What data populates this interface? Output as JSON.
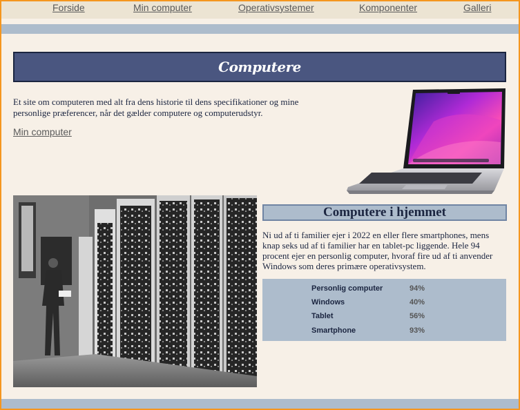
{
  "nav": {
    "items": [
      {
        "label": "Forside"
      },
      {
        "label": "Min computer"
      },
      {
        "label": "Operativsystemer"
      },
      {
        "label": "Komponenter"
      },
      {
        "label": "Galleri"
      }
    ]
  },
  "hero": {
    "title": "Computere"
  },
  "intro": {
    "text": "Et site om computeren med alt fra dens historie til dens specifikationer og mine personlige præferencer, når det gælder computere og computerudstyr.",
    "link_label": "Min computer"
  },
  "images": {
    "laptop": "laptop-photo",
    "servers": "server-room-photo"
  },
  "home_section": {
    "heading": "Computere i hjemmet",
    "body": "Ni ud af ti familier ejer i 2022 en eller flere smartphones, mens knap seks ud af ti familier har en tablet-pc liggende. Hele 94 procent ejer en personlig computer, hvoraf fire ud af ti anvender Windows som deres primære operativsystem.",
    "stats": [
      {
        "name": "Personlig computer",
        "value": "94%"
      },
      {
        "name": "Windows",
        "value": "40%"
      },
      {
        "name": "Tablet",
        "value": "56%"
      },
      {
        "name": "Smartphone",
        "value": "93%"
      }
    ]
  },
  "colors": {
    "page_bg": "#f7f0e7",
    "nav_bg": "#ece4d3",
    "band": "#adbccc",
    "hero_bg": "#4a5680",
    "text": "#1b2540",
    "frame": "#f5961e"
  }
}
